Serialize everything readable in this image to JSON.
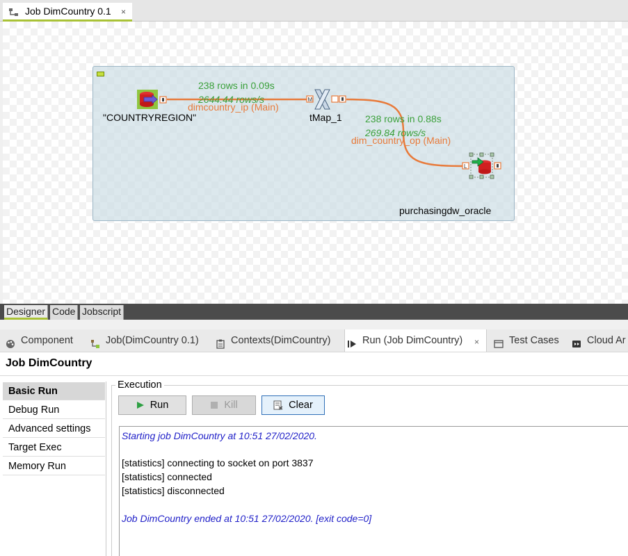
{
  "editor": {
    "tab_title": "Job DimCountry 0.1",
    "close_glyph": "×"
  },
  "canvas": {
    "components": {
      "source": "\"COUNTRYREGION\"",
      "map": "tMap_1",
      "target": "purchasingdw_oracle"
    },
    "connections": {
      "first": {
        "name": "dimcountry_ip (Main)",
        "rows": "238 rows in 0.09s",
        "rate": "2644.44 rows/s"
      },
      "second": {
        "name": "dim_country_op (Main)",
        "rows": "238 rows in 0.88s",
        "rate": "269.84 rows/s"
      }
    },
    "connector_letters": {
      "main": "M",
      "lookup": "L"
    }
  },
  "designer_tabs": [
    "Designer",
    "Code",
    "Jobscript"
  ],
  "view_tabs": {
    "component": "Component",
    "job": "Job(DimCountry 0.1)",
    "contexts": "Contexts(DimCountry)",
    "run": "Run (Job DimCountry)",
    "test_cases": "Test Cases",
    "cloud": "Cloud Ar",
    "close_glyph": "×"
  },
  "panel": {
    "title": "Job DimCountry",
    "nav": [
      "Basic Run",
      "Debug Run",
      "Advanced settings",
      "Target Exec",
      "Memory Run"
    ],
    "execution_label": "Execution",
    "buttons": {
      "run": "Run",
      "kill": "Kill",
      "clear": "Clear"
    }
  },
  "console": {
    "lines": [
      "Starting job DimCountry at 10:51 27/02/2020.",
      "[statistics] connecting to socket on port 3837",
      "[statistics] connected",
      "[statistics] disconnected",
      "Job DimCountry ended at 10:51 27/02/2020. [exit code=0]"
    ]
  },
  "colors": {
    "accent_green": "#a9c236",
    "stat_green": "#3aa03a",
    "connection_orange": "#e87a3a",
    "console_blue": "#2020c8"
  }
}
